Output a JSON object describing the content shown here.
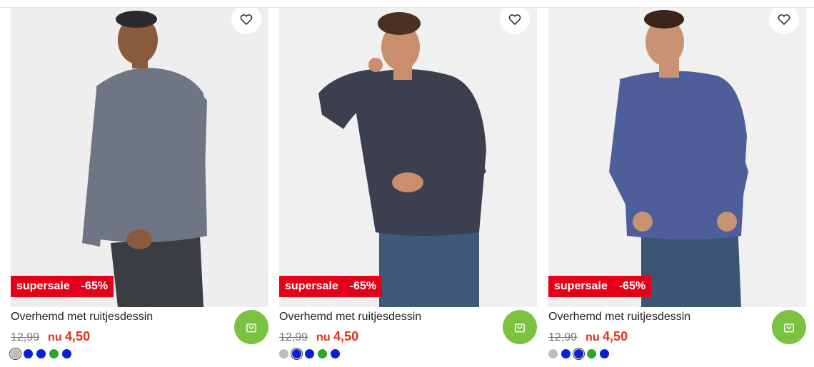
{
  "products": [
    {
      "title": "Overhemd met ruitjesdessin",
      "badge_label": "supersale",
      "badge_discount": "-65%",
      "old_price": "12,99",
      "price_prefix": "nu",
      "new_price": "4,50",
      "swatches": [
        "#bdbdbd",
        "#0a1fd6",
        "#0a1fd6",
        "#2fa32f",
        "#0a1fd6"
      ],
      "active_swatch": 0,
      "shirt_color": "#6f7585",
      "pants_color": "#3a3d42"
    },
    {
      "title": "Overhemd met ruitjesdessin",
      "badge_label": "supersale",
      "badge_discount": "-65%",
      "old_price": "12,99",
      "price_prefix": "nu",
      "new_price": "4,50",
      "swatches": [
        "#bdbdbd",
        "#0a1fd6",
        "#0a1fd6",
        "#2fa32f",
        "#0a1fd6"
      ],
      "active_swatch": 1,
      "shirt_color": "#3c3f4f",
      "pants_color": "#3f5a78"
    },
    {
      "title": "Overhemd met ruitjesdessin",
      "badge_label": "supersale",
      "badge_discount": "-65%",
      "old_price": "12,99",
      "price_prefix": "nu",
      "new_price": "4,50",
      "swatches": [
        "#bdbdbd",
        "#0a1fd6",
        "#0a1fd6",
        "#2fa32f",
        "#0a1fd6"
      ],
      "active_swatch": 2,
      "shirt_color": "#4e5e9a",
      "pants_color": "#3d5574"
    }
  ],
  "colors": {
    "sale_red": "#e50019",
    "price_red": "#e0301e",
    "cart_green": "#7cc242"
  },
  "icons": {
    "wishlist": "heart-icon",
    "cart": "shopping-bag-icon"
  }
}
